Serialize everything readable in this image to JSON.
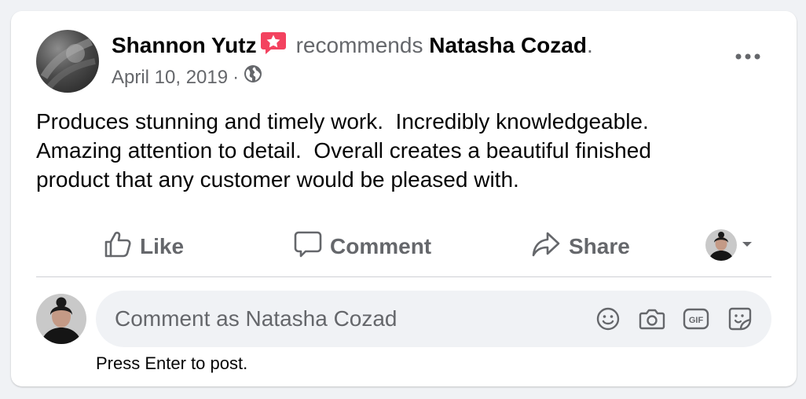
{
  "post": {
    "author": "Shannon Yutz",
    "verb": "recommends",
    "target": "Natasha Cozad",
    "period": ".",
    "date": "April 10, 2019",
    "separator": "·",
    "text": "Produces stunning and timely work.  Incredibly knowledgeable.\nAmazing attention to detail.  Overall creates a beautiful finished\nproduct that any customer would be pleased with."
  },
  "icons": {
    "badge": "recommendation-star-icon",
    "privacy": "globe-icon",
    "more": "more-options-icon",
    "like": "thumbs-up-icon",
    "comment": "speech-bubble-icon",
    "share": "share-arrow-icon",
    "audience_caret": "caret-down-icon",
    "emoji": "emoji-icon",
    "camera": "camera-icon",
    "gif": "gif-icon",
    "sticker": "sticker-icon"
  },
  "actions": {
    "like": "Like",
    "comment": "Comment",
    "share": "Share"
  },
  "composer": {
    "placeholder": "Comment as Natasha Cozad",
    "hint": "Press Enter to post.",
    "gif_label": "GIF"
  },
  "colors": {
    "badge": "#f3425f",
    "secondary_text": "#65676b",
    "primary_text": "#050505",
    "composer_bg": "#f0f2f5"
  }
}
